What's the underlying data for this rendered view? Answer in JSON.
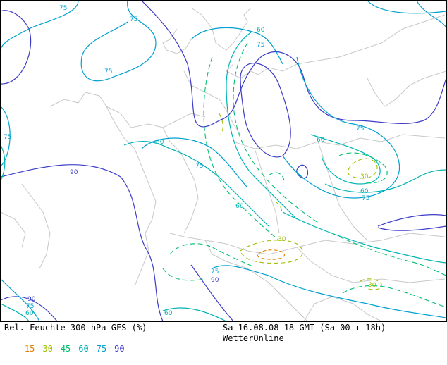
{
  "map": {
    "contour_labels": [
      {
        "text": "75",
        "color": "#00c8c8"
      },
      {
        "text": "75",
        "color": "#00c8c8"
      },
      {
        "text": "75",
        "color": "#00c8c8"
      },
      {
        "text": "60",
        "color": "#00c8c8"
      },
      {
        "text": "75",
        "color": "#00c8c8"
      },
      {
        "text": "60",
        "color": "#00c8c8"
      },
      {
        "text": "75",
        "color": "#00c8c8"
      },
      {
        "text": "90",
        "color": "#3c3cc8"
      },
      {
        "text": "75",
        "color": "#00c8c8"
      },
      {
        "text": "60",
        "color": "#00c8c8"
      },
      {
        "text": "75",
        "color": "#00c8c8"
      },
      {
        "text": "60",
        "color": "#00c8c8"
      },
      {
        "text": "30",
        "color": "#a0c000"
      },
      {
        "text": "60",
        "color": "#00c8c8"
      },
      {
        "text": "75",
        "color": "#00c8c8"
      },
      {
        "text": "30",
        "color": "#a0c000"
      },
      {
        "text": "30",
        "color": "#a0c000"
      },
      {
        "text": "75",
        "color": "#00c8c8"
      },
      {
        "text": "90",
        "color": "#3c3cc8"
      },
      {
        "text": "90",
        "color": "#3c3cc8"
      },
      {
        "text": "75",
        "color": "#00c8c8"
      },
      {
        "text": "60",
        "color": "#00c8c8"
      },
      {
        "text": "60",
        "color": "#00c8c8"
      }
    ]
  },
  "footer": {
    "title": "Rel. Feuchte 300 hPa GFS (%)",
    "legend": [
      {
        "value": "15",
        "color": "#e08000"
      },
      {
        "value": "30",
        "color": "#a0c000"
      },
      {
        "value": "45",
        "color": "#00c070"
      },
      {
        "value": "60",
        "color": "#00b4b4"
      },
      {
        "value": "75",
        "color": "#00a0d0"
      },
      {
        "value": "90",
        "color": "#3c3cc8"
      }
    ],
    "datetime": "Sa 16.08.08 18 GMT (Sa 00 + 18h)",
    "brand": "WetterOnline"
  }
}
